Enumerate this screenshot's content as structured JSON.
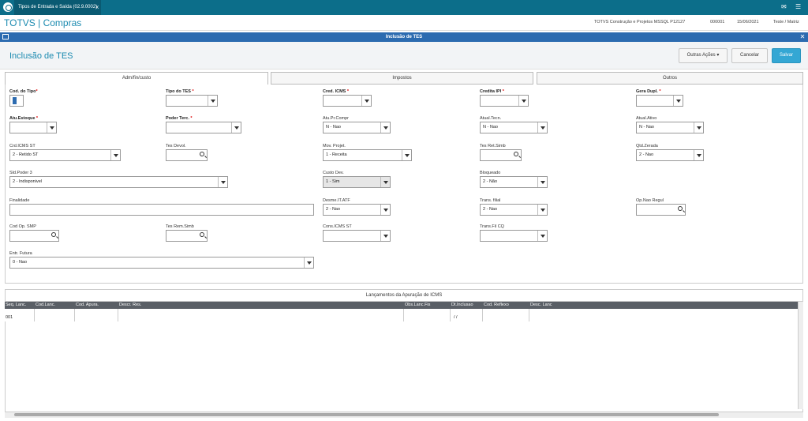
{
  "tab": {
    "title": "Tipos de Entrada e Saída (02.9.0002)",
    "close": "x"
  },
  "header": {
    "brand": "TOTVS | Compras",
    "env": "TOTVS Construção e Projetos MSSQL P12127",
    "code": "000001",
    "date": "15/06/2021",
    "branch": "Teste / Matriz"
  },
  "dialog": {
    "title": "Inclusão de TES"
  },
  "page": {
    "title": "Inclusão de TES"
  },
  "buttons": {
    "more": "Outras Ações",
    "cancel": "Cancelar",
    "save": "Salvar"
  },
  "tabs": [
    "Adm/fin/custo",
    "Impostos",
    "Outros"
  ],
  "labels": {
    "cod_tipo": "Cod. do Tipo",
    "tipo_tes": "Tipo do TES",
    "cred_icms": "Cred. ICMS",
    "credita_ipi": "Credita IPI",
    "gera_dupl": "Gera Dupl.",
    "atu_estoque": "Atu.Estoque",
    "poder_terc": "Poder Terc.",
    "atu_pr_compr": "Atu.Pr.Compr",
    "atual_tecn": "Atual.Tecn.",
    "atual_ativo": "Atual.Ativo",
    "crd_icms_st": "Crd.ICMS ST",
    "tes_devol": "Tes Devol.",
    "mov_projet": "Mov. Projet.",
    "tes_ret_simb": "Tes Ret.Simb",
    "qtd_zerada": "Qtd.Zerada",
    "sld_poder3": "Sld.Poder 3",
    "custo_dev": "Custo Dev.",
    "bloqueado": "Bloqueado",
    "finalidade": "Finalidade",
    "desme_it_atf": "Desme.IT.ATF",
    "trans_filial": "Trans. filial",
    "op_nao_regul": "Op.Nao Regul",
    "cod_op_smp": "Cod Op. SMP",
    "tes_rem_simb": "Tes Rem.Simb",
    "cons_icms_st": "Cons.ICMS ST",
    "trans_fil_cq": "Trans.Fil CQ",
    "entr_futura": "Entr. Futura"
  },
  "req_mark": "*",
  "values": {
    "atu_pr_compr": "N - Nao",
    "atual_tecn": "N - Nao",
    "atual_ativo": "N - Nao",
    "crd_icms_st": "2 - Retido ST",
    "mov_projet": "1 - Receita",
    "qtd_zerada": "2 - Nao",
    "sld_poder3": "2 - Indisponivel",
    "custo_dev": "1 - Sim",
    "bloqueado": "2 - Não",
    "desme_it_atf": "2 - Nao",
    "trans_filial": "2 - Nao",
    "entr_futura": "0 - Nao"
  },
  "grid": {
    "title": "Lançamentos da Apuração de ICMS",
    "columns": [
      "Seq. Lanc.",
      "Cod.Lanc.",
      "Cod. Apura.",
      "Descr. Res.",
      "Obs.Lanc.Fis",
      "Dt.Inclusao",
      "Cod. Reflexo",
      "Desc. Lanc"
    ],
    "row": [
      "001",
      "",
      "",
      "",
      "",
      "/ /",
      "",
      ""
    ]
  }
}
